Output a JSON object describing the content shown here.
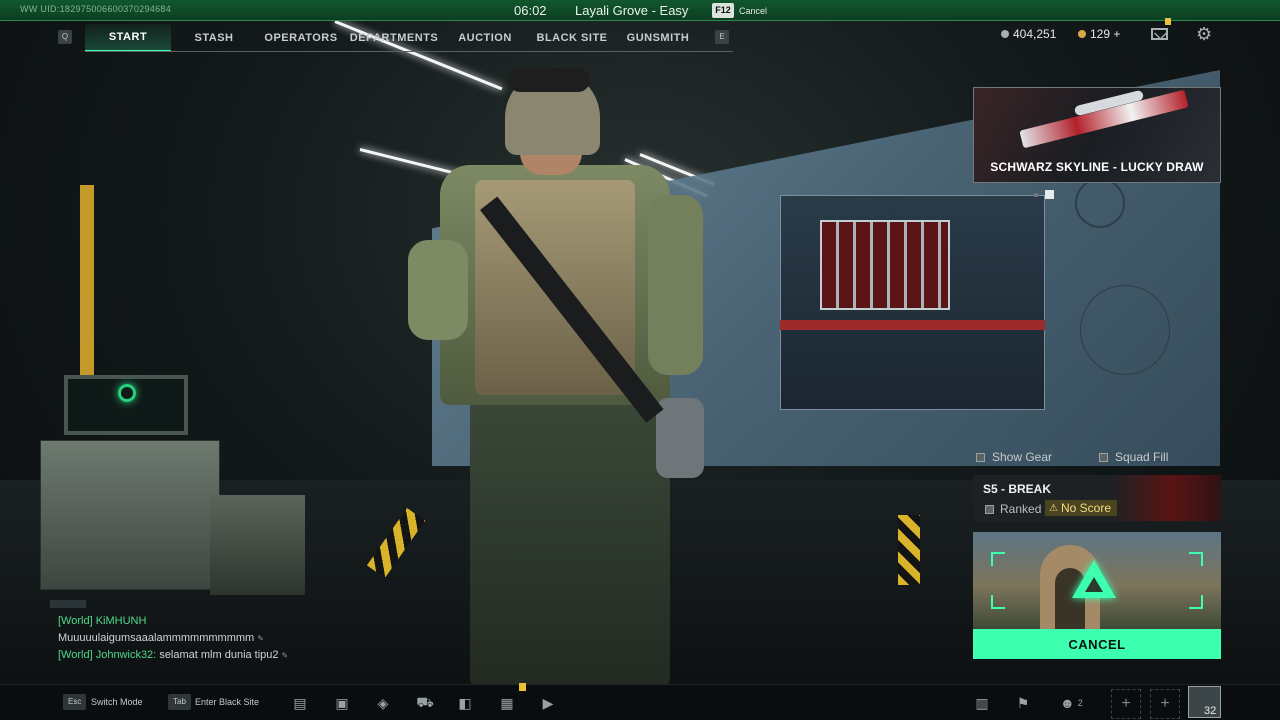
{
  "status_bar": {
    "uid": "WW UID:18297500660037029​4684",
    "time": "06:02",
    "map": "Layali Grove - Easy",
    "key": "F12",
    "key_label": "Cancel"
  },
  "nav": {
    "left_key": "Q",
    "right_key": "E",
    "tabs": [
      {
        "label": "START",
        "active": true
      },
      {
        "label": "STASH",
        "active": false
      },
      {
        "label": "OPERATORS",
        "active": false
      },
      {
        "label": "DEPARTMENTS",
        "active": false
      },
      {
        "label": "AUCTION",
        "active": false
      },
      {
        "label": "BLACK SITE",
        "active": false
      },
      {
        "label": "GUNSMITH",
        "active": false
      }
    ]
  },
  "currency": {
    "silver": "404,251",
    "gold": "129 +"
  },
  "icons": {
    "mail": "mail-icon",
    "settings": "gear-icon"
  },
  "promo": {
    "title": "SCHWARZ SKYLINE - LUCKY DRAW"
  },
  "toggles": {
    "show_gear": "Show Gear",
    "squad_fill": "Squad Fill"
  },
  "season": {
    "title": "S5 - BREAK",
    "ranked": "Ranked",
    "no_score": "No Score"
  },
  "matchmaking": {
    "cancel_label": "CANCEL"
  },
  "chat": {
    "lines": [
      {
        "channel": "[World]",
        "name": "KiMHUNH",
        "message": ""
      },
      {
        "channel": "",
        "name": "",
        "message": "Muuuuulaigumsaaalammmmmmmmmm"
      },
      {
        "channel": "[World]",
        "name": "Johnwick32:",
        "message": "selamat mlm dunia tipu2"
      }
    ]
  },
  "bottom_bar": {
    "esc_key": "Esc",
    "switch_mode": "Switch Mode",
    "tab_key": "Tab",
    "enter_black_site": "Enter Black Site",
    "squad_count": "2",
    "level": "32"
  },
  "colors": {
    "accent": "#3cffb0",
    "status_bar": "#11572d",
    "warning": "#e9c23a"
  }
}
